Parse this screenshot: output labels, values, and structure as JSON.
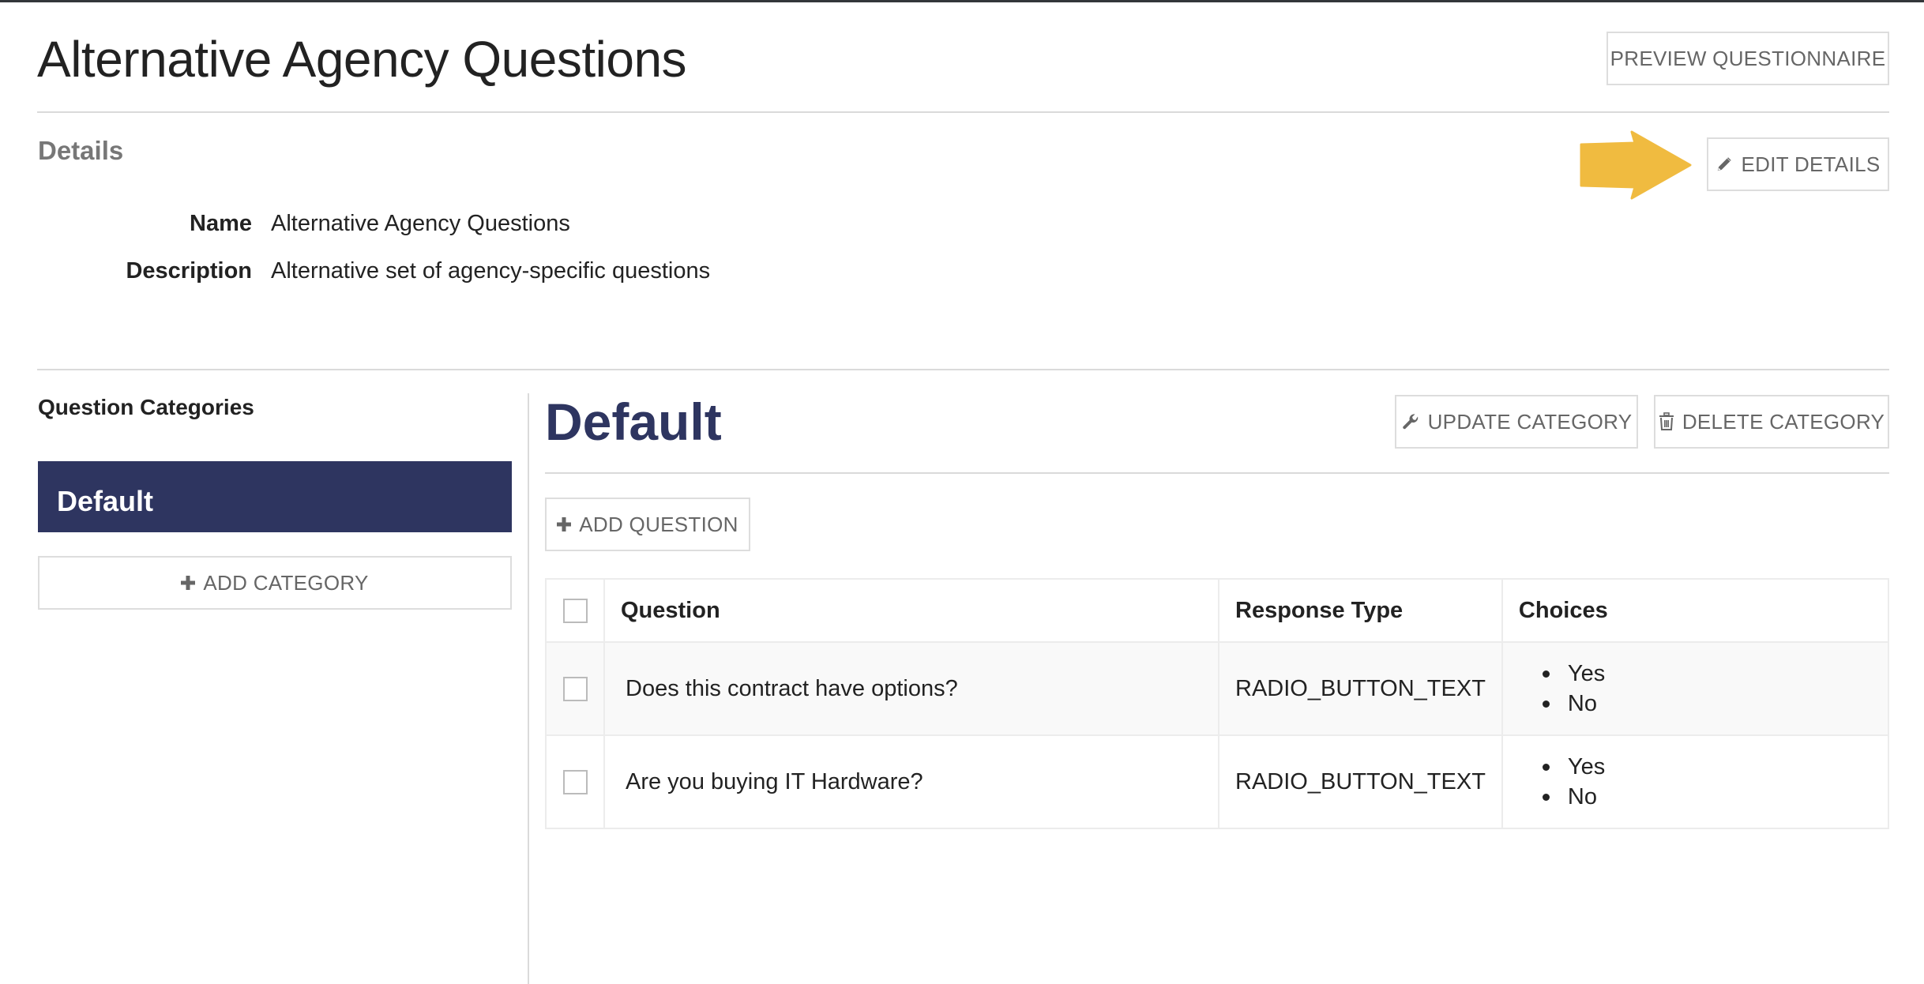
{
  "page": {
    "title": "Alternative Agency Questions",
    "preview_button": "PREVIEW QUESTIONNAIRE"
  },
  "details": {
    "heading": "Details",
    "edit_button": "EDIT DETAILS",
    "fields": [
      {
        "label": "Name",
        "value": "Alternative Agency Questions"
      },
      {
        "label": "Description",
        "value": "Alternative set of agency-specific questions"
      }
    ]
  },
  "annotation": {
    "arrow_color": "#f0bb40"
  },
  "sidebar": {
    "heading": "Question Categories",
    "categories": [
      {
        "label": "Default",
        "selected": true
      }
    ],
    "add_category_button": "ADD CATEGORY"
  },
  "main": {
    "category_title": "Default",
    "update_button": "UPDATE CATEGORY",
    "delete_button": "DELETE CATEGORY",
    "add_question_button": "ADD QUESTION",
    "table": {
      "columns": [
        "",
        "Question",
        "Response Type",
        "Choices"
      ],
      "rows": [
        {
          "checked": false,
          "question": "Does this contract have options?",
          "response_type": "RADIO_BUTTON_TEXT",
          "choices": [
            "Yes",
            "No"
          ]
        },
        {
          "checked": false,
          "question": "Are you buying IT Hardware?",
          "response_type": "RADIO_BUTTON_TEXT",
          "choices": [
            "Yes",
            "No"
          ]
        }
      ]
    }
  },
  "colors": {
    "brand_navy": "#2e3560",
    "button_text": "#666666",
    "border": "#dddddd"
  }
}
